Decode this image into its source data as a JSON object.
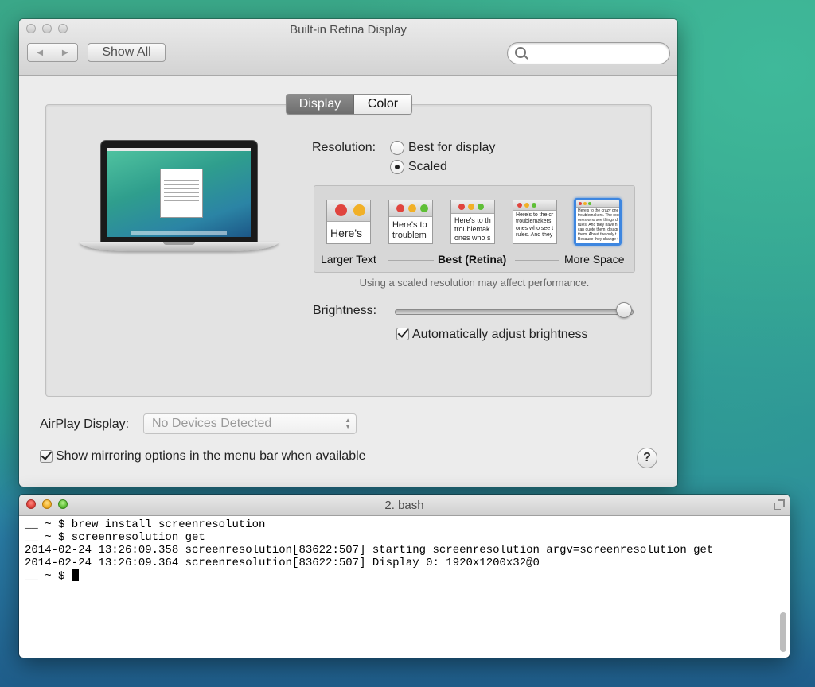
{
  "prefs_window": {
    "title": "Built-in Retina Display",
    "nav_back": "◀",
    "nav_forward": "▶",
    "show_all": "Show All",
    "search_placeholder": "",
    "tabs": [
      {
        "label": "Display",
        "active": true
      },
      {
        "label": "Color",
        "active": false
      }
    ],
    "resolution": {
      "label": "Resolution:",
      "options": [
        {
          "label": "Best for display",
          "selected": false
        },
        {
          "label": "Scaled",
          "selected": true
        }
      ]
    },
    "scaled_options": [
      {
        "preview_text": "Here's",
        "selected": false
      },
      {
        "preview_text": "Here's to\ntroublem",
        "selected": false
      },
      {
        "preview_text": "Here's to th\ntroublemak\nones who s",
        "selected": false
      },
      {
        "preview_text": "Here's to the cr\ntroublemakers.\nones who see t\nrules. And they",
        "selected": false
      },
      {
        "preview_text": "Here's to the crazy one\ntroublemakers. The rou\nones who see things di\nrules. And they have n\ncan quote them, disagr\nthem. About the only t\nBecause they change t",
        "selected": true
      }
    ],
    "scale_labels": {
      "left": "Larger Text",
      "middle": "Best (Retina)",
      "right": "More Space"
    },
    "performance_note": "Using a scaled resolution may affect performance.",
    "brightness": {
      "label": "Brightness:",
      "level": 1.0
    },
    "auto_brightness": {
      "label": "Automatically adjust brightness",
      "checked": true
    },
    "airplay": {
      "label": "AirPlay Display:",
      "value": "No Devices Detected"
    },
    "mirroring": {
      "label": "Show mirroring options in the menu bar when available",
      "checked": true
    },
    "help": "?"
  },
  "terminal": {
    "title": "2. bash",
    "lines": [
      "__ ~ $ brew install screenresolution",
      "__ ~ $ screenresolution get",
      "2014-02-24 13:26:09.358 screenresolution[83622:507] starting screenresolution argv=screenresolution get",
      "2014-02-24 13:26:09.364 screenresolution[83622:507] Display 0: 1920x1200x32@0",
      "__ ~ $ "
    ]
  },
  "colors": {
    "accent_blue": "#3d86e0",
    "close_red": "#e0443e",
    "minimize_yellow": "#f1b027",
    "zoom_green": "#5fbf36"
  }
}
